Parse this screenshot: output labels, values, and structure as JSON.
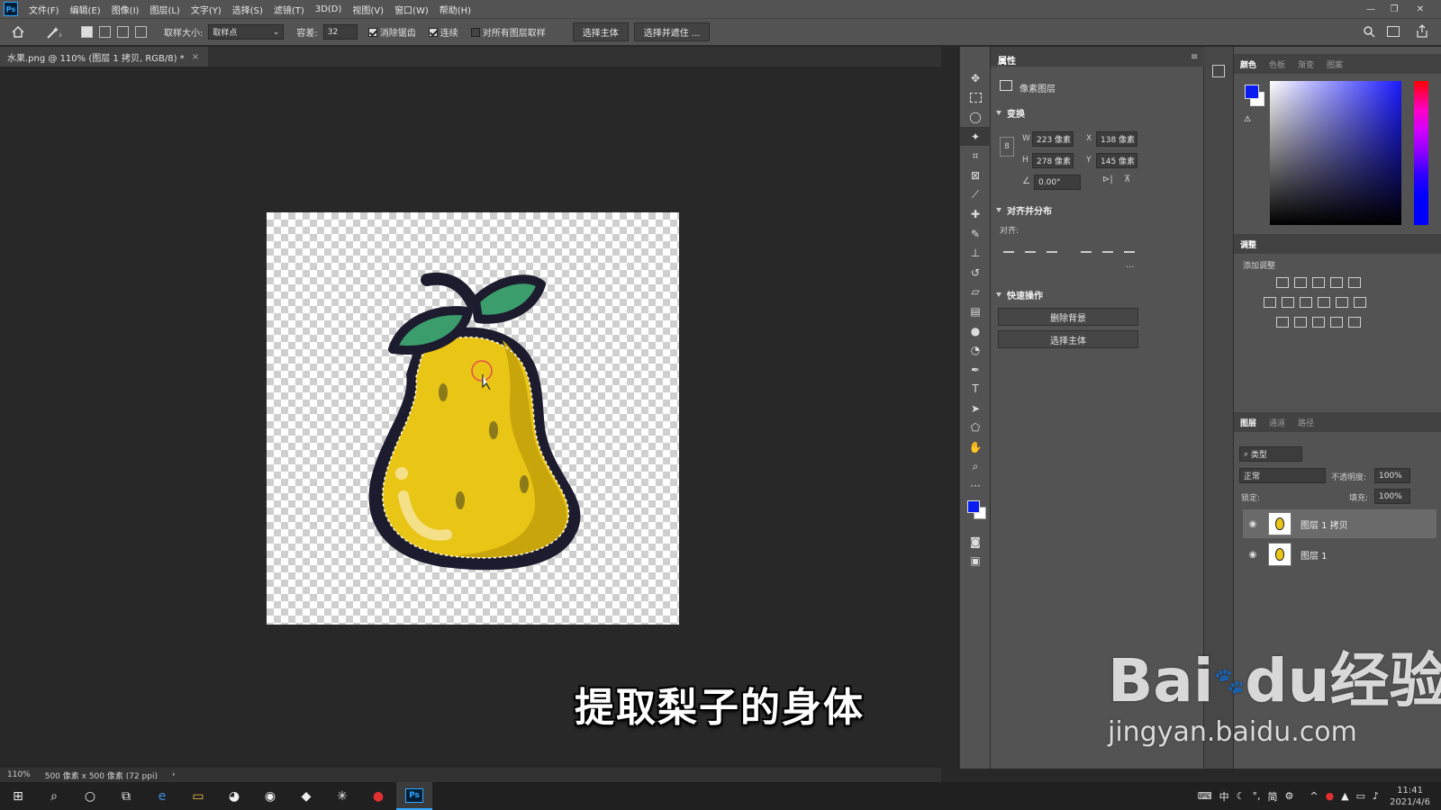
{
  "app": {
    "logo": "Ps"
  },
  "menu": [
    "文件(F)",
    "编辑(E)",
    "图像(I)",
    "图层(L)",
    "文字(Y)",
    "选择(S)",
    "滤镜(T)",
    "3D(D)",
    "视图(V)",
    "窗口(W)",
    "帮助(H)"
  ],
  "window_controls": [
    "—",
    "❐",
    "✕"
  ],
  "options": {
    "sample_size_label": "取样大小:",
    "sample_size_value": "取样点",
    "tolerance_label": "容差:",
    "tolerance_value": "32",
    "antialias_label": "消除锯齿",
    "contiguous_label": "连续",
    "sample_all_label": "对所有图层取样",
    "select_subject": "选择主体",
    "select_mask": "选择并遮住 ..."
  },
  "document": {
    "tab_title": "水果.png @ 110% (图层 1 拷贝, RGB/8) *",
    "close": "×",
    "zoom": "110%",
    "doc_info": "500 像素 x 500 像素 (72 ppi)",
    "arrow": "›"
  },
  "caption": "提取梨子的身体",
  "properties": {
    "tab": "属性",
    "layer_type": "像素图层",
    "transform_title": "变换",
    "w_label": "W",
    "w_value": "223 像素",
    "x_label": "X",
    "x_value": "138 像素",
    "h_label": "H",
    "h_value": "278 像素",
    "y_label": "Y",
    "y_value": "145 像素",
    "angle_value": "0.00°",
    "align_title": "对齐并分布",
    "align_label": "对齐:",
    "more": "···",
    "quick_title": "快速操作",
    "remove_bg": "删除背景",
    "select_subject": "选择主体"
  },
  "color_panel": {
    "tabs": [
      "颜色",
      "色板",
      "渐变",
      "图案"
    ],
    "fg_color": "#0a1cf0",
    "bg_color": "#ffffff"
  },
  "adjust_panel": {
    "tab": "调整",
    "add_label": "添加调整"
  },
  "layers_panel": {
    "tabs": [
      "图层",
      "通道",
      "路径"
    ],
    "kind_label": "类型",
    "blend_mode": "正常",
    "opacity_label": "不透明度:",
    "opacity_value": "100%",
    "lock_label": "锁定:",
    "fill_label": "填充:",
    "fill_value": "100%",
    "layers": [
      {
        "name": "图层 1 拷贝",
        "selected": true
      },
      {
        "name": "图层 1",
        "selected": false
      }
    ]
  },
  "watermark": {
    "brand": "Bai",
    "du": "du",
    "jingyan": "经验",
    "url": "jingyan.baidu.com"
  },
  "taskbar": {
    "ime": "中",
    "ime2": "简",
    "time": "11:41",
    "date": "2021/4/6"
  },
  "colors": {
    "accent": "#31a8ff",
    "pear": "#e9c515",
    "pear_shadow": "#c9a50c",
    "leaf": "#3a9d6b",
    "outline": "#1c1c2e"
  }
}
